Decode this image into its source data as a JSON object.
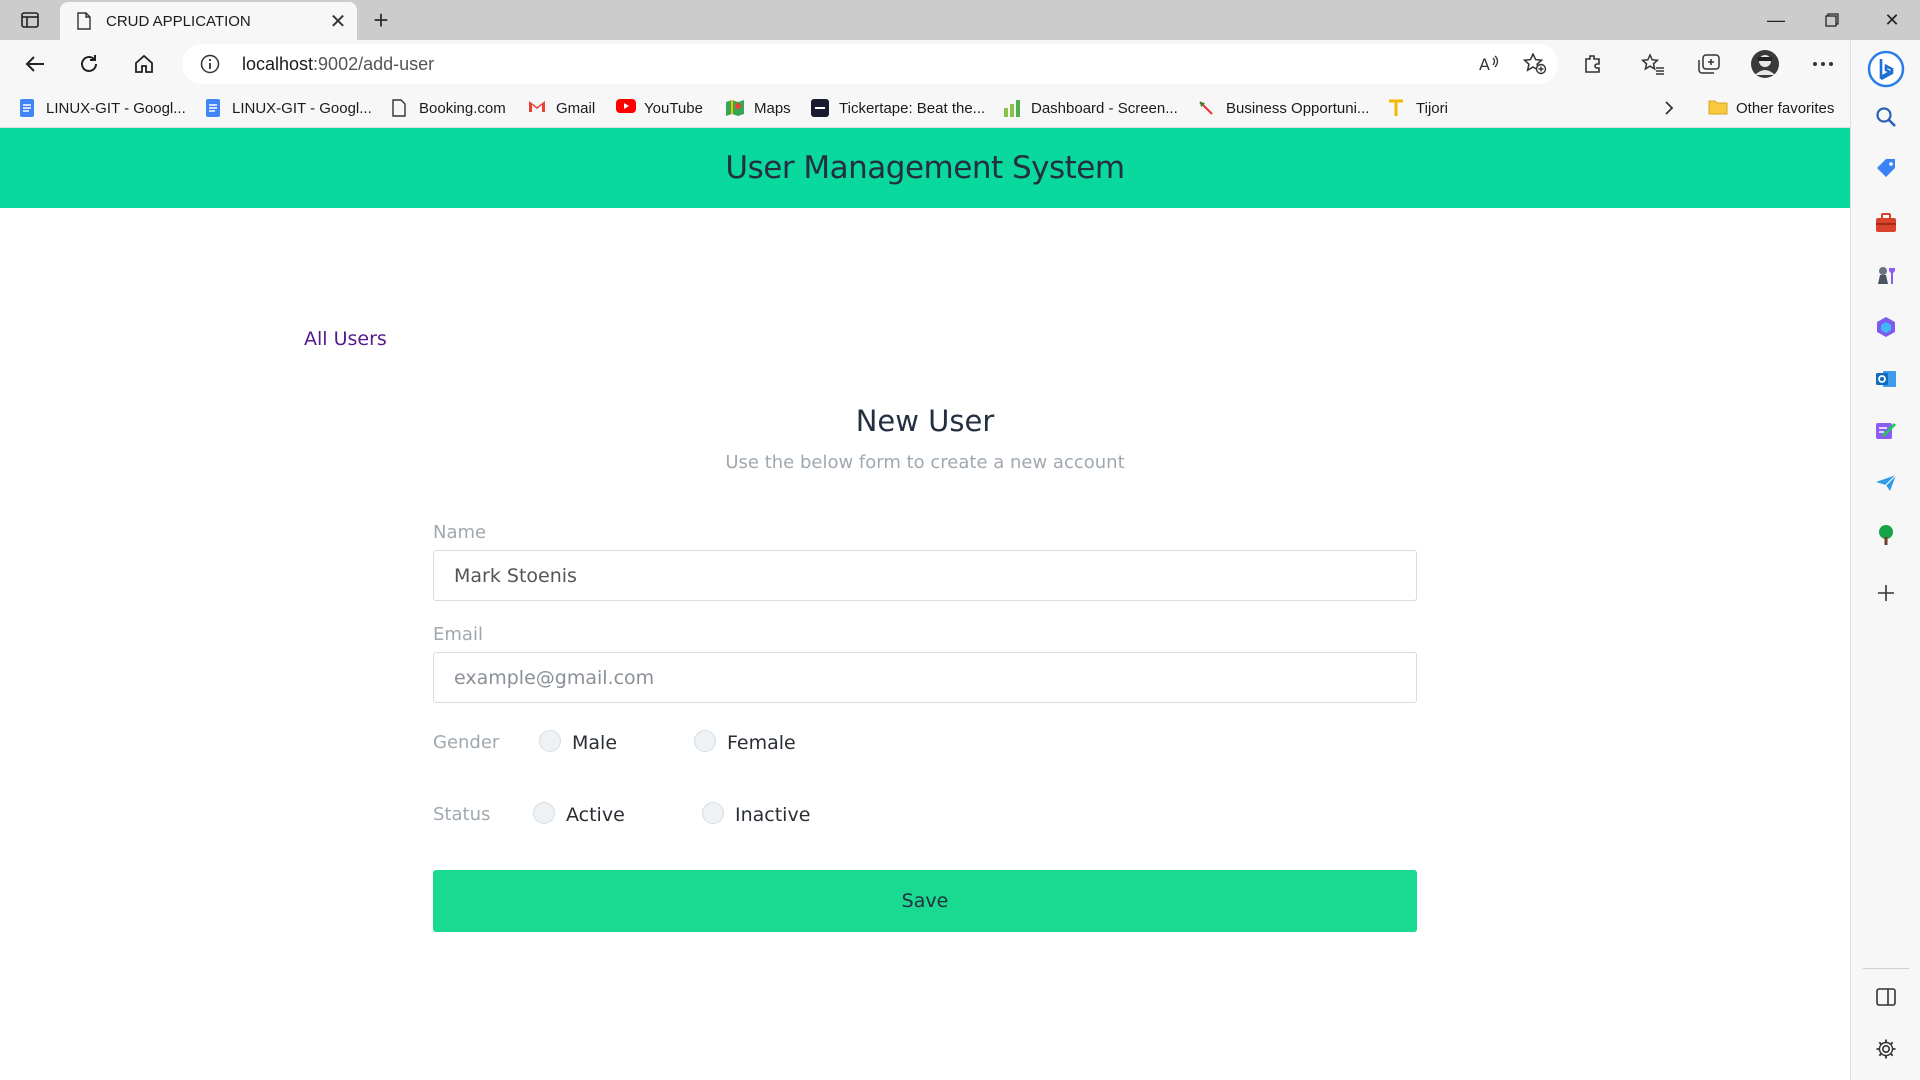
{
  "browser": {
    "tab_title": "CRUD APPLICATION",
    "url_host": "localhost",
    "url_path": ":9002/add-user",
    "bookmarks": [
      {
        "label": "LINUX-GIT - Googl...",
        "icon": "google-docs-icon"
      },
      {
        "label": "LINUX-GIT - Googl...",
        "icon": "google-docs-icon"
      },
      {
        "label": "Booking.com",
        "icon": "page-icon"
      },
      {
        "label": "Gmail",
        "icon": "gmail-icon"
      },
      {
        "label": "YouTube",
        "icon": "youtube-icon"
      },
      {
        "label": "Maps",
        "icon": "maps-icon"
      },
      {
        "label": "Tickertape: Beat the...",
        "icon": "tickertape-icon"
      },
      {
        "label": "Dashboard - Screen...",
        "icon": "bar-chart-icon"
      },
      {
        "label": "Business Opportuni...",
        "icon": "arrow-icon"
      },
      {
        "label": "Tijori",
        "icon": "tijori-icon"
      }
    ],
    "other_favorites": "Other favorites"
  },
  "app": {
    "title": "User Management System",
    "all_users_link": "All Users"
  },
  "form": {
    "title": "New User",
    "subtitle": "Use the below form to create a new account",
    "name_label": "Name",
    "name_value": "Mark Stoenis",
    "email_label": "Email",
    "email_placeholder": "example@gmail.com",
    "gender_label": "Gender",
    "gender_options": [
      "Male",
      "Female"
    ],
    "status_label": "Status",
    "status_options": [
      "Active",
      "Inactive"
    ],
    "save_label": "Save"
  },
  "colors": {
    "header_bg": "#0ad99e",
    "save_bg": "#19da90",
    "link": "#551a8b"
  }
}
